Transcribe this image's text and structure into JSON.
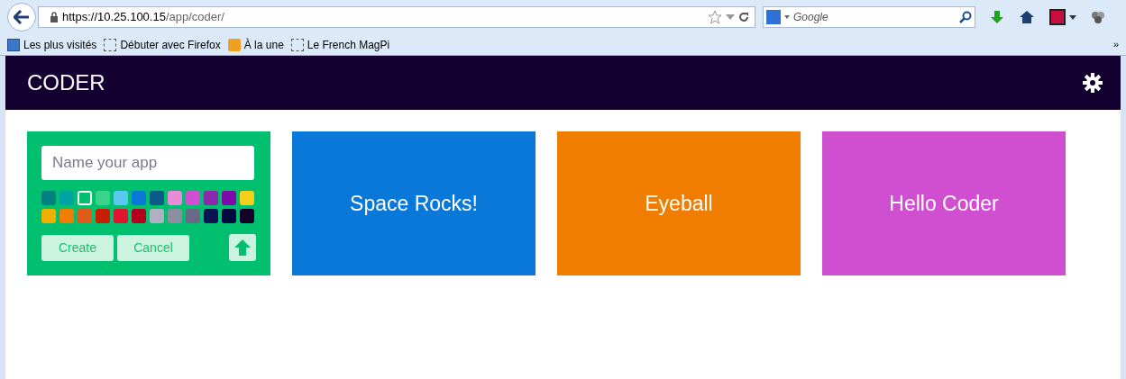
{
  "browser": {
    "url_host": "https://10.25.100.15",
    "url_path": "/app/coder/",
    "search_placeholder": "Google",
    "bookmarks": [
      {
        "label": "Les plus visités",
        "kind": "search"
      },
      {
        "label": "Débuter avec Firefox",
        "kind": "blank"
      },
      {
        "label": "À la une",
        "kind": "rss"
      },
      {
        "label": "Le French MagPi",
        "kind": "blank"
      }
    ],
    "overflow": "»"
  },
  "app": {
    "title": "CODER"
  },
  "new_app": {
    "placeholder": "Name your app",
    "colors": [
      {
        "color": "#008080",
        "selected": false
      },
      {
        "color": "#00a3a3",
        "selected": false
      },
      {
        "color": "#00bf6f",
        "selected": true
      },
      {
        "color": "#3ad38a",
        "selected": false
      },
      {
        "color": "#5ac8f0",
        "selected": false
      },
      {
        "color": "#0a78d8",
        "selected": false
      },
      {
        "color": "#0a5a8a",
        "selected": false
      },
      {
        "color": "#e98bd8",
        "selected": false
      },
      {
        "color": "#d04fd0",
        "selected": false
      },
      {
        "color": "#8b2aad",
        "selected": false
      },
      {
        "color": "#7b0aa8",
        "selected": false
      },
      {
        "color": "#f5d018",
        "selected": false
      },
      {
        "color": "#f0b000",
        "selected": false
      },
      {
        "color": "#f07c00",
        "selected": false
      },
      {
        "color": "#e05a1a",
        "selected": false
      },
      {
        "color": "#c81e00",
        "selected": false
      },
      {
        "color": "#e0142e",
        "selected": false
      },
      {
        "color": "#b4001e",
        "selected": false
      },
      {
        "color": "#b0b0c0",
        "selected": false
      },
      {
        "color": "#8a8ea0",
        "selected": false
      },
      {
        "color": "#6a6a88",
        "selected": false
      },
      {
        "color": "#0a1450",
        "selected": false
      },
      {
        "color": "#000a40",
        "selected": false
      },
      {
        "color": "#140028",
        "selected": false
      }
    ],
    "buttons": [
      "Create",
      "Cancel"
    ]
  },
  "apps": [
    {
      "name": "Space Rocks!",
      "color": "#0a78d8"
    },
    {
      "name": "Eyeball",
      "color": "#f07c00"
    },
    {
      "name": "Hello Coder",
      "color": "#d04fd0"
    }
  ]
}
